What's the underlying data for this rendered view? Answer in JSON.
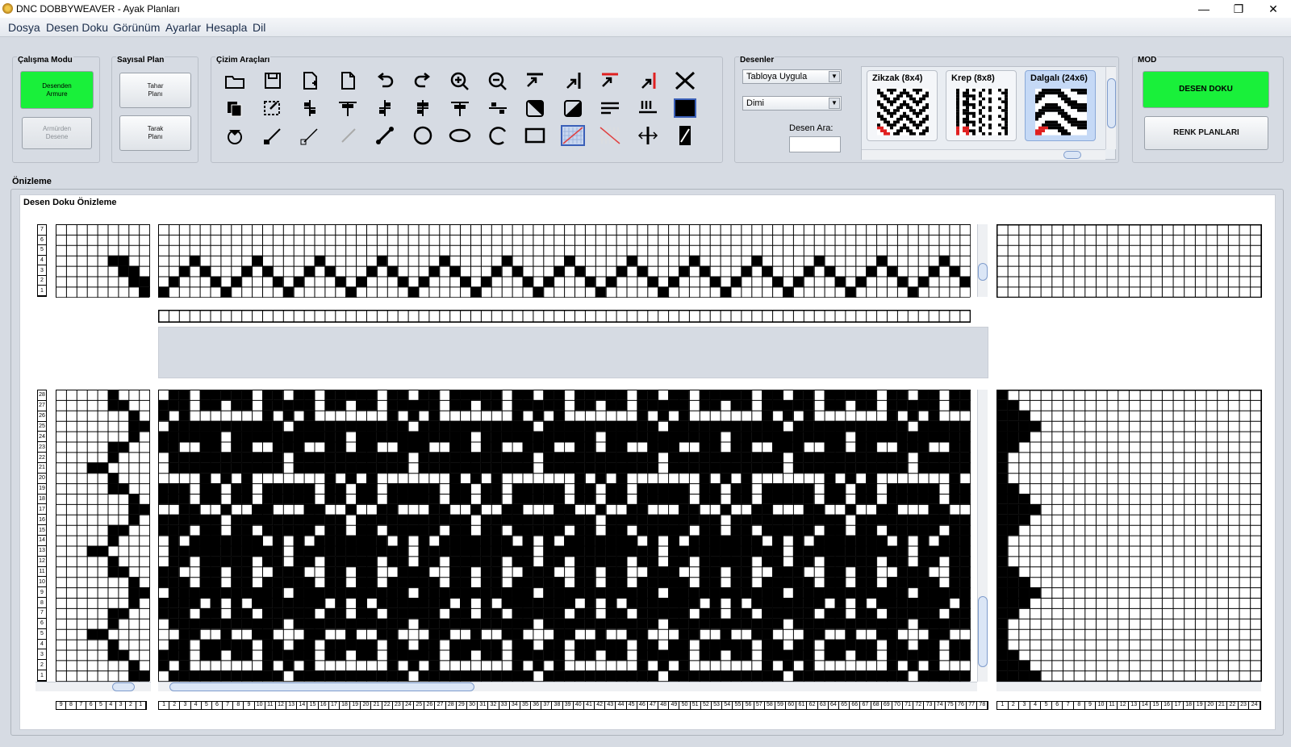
{
  "window": {
    "title": "DNC DOBBYWEAVER - Ayak Planları",
    "minimize": "—",
    "maximize": "❐",
    "close": "✕"
  },
  "menu": [
    "Dosya",
    "Desen Doku",
    "Görünüm",
    "Ayarlar",
    "Hesapla",
    "Dil"
  ],
  "calisma_modu": {
    "title": "Çalışma Modu",
    "btn1": "Desenden\nArmure",
    "btn2": "Armürden\nDesene"
  },
  "sayisal_plan": {
    "title": "Sayısal Plan",
    "btn1": "Tahar\nPlanı",
    "btn2": "Tarak\nPlanı"
  },
  "cizim": {
    "title": "Çizim Araçları",
    "tools": [
      "open-folder-icon",
      "save-icon",
      "new-page-icon",
      "copy-page-icon",
      "undo-icon",
      "redo-icon",
      "zoom-in-icon",
      "zoom-out-icon",
      "align-top-icon",
      "align-right-icon",
      "red-line-icon",
      "red-arrow-icon",
      "close-x-icon",
      "duplicate-icon",
      "select-icon",
      "shift-left-icon",
      "shift-up-icon",
      "shift-down-icon",
      "mirror-icon",
      "flip-icon",
      "compress-icon",
      "invert-icon",
      "fill-icon",
      "rows-icon",
      "columns-icon",
      "black-fill-icon",
      "rotate-icon",
      "line-icon",
      "line-dot-icon",
      "line-light-icon",
      "segment-icon",
      "circle-icon",
      "ellipse-icon",
      "arc-icon",
      "rectangle-icon",
      "grid-fill-icon",
      "diagonal-icon",
      "flip-h-icon",
      "stripe-icon"
    ]
  },
  "desenler": {
    "title": "Desenler",
    "combo1": "Tabloya Uygula",
    "combo2": "Dimi",
    "search_label": "Desen Ara:",
    "search_value": ""
  },
  "patterns": [
    {
      "name": "Zikzak (8x4)"
    },
    {
      "name": "Krep (8x8)"
    },
    {
      "name": "Dalgalı (24x6)"
    }
  ],
  "mod": {
    "title": "MOD",
    "btn1": "DESEN DOKU",
    "btn2": "RENK PLANLARI"
  },
  "preview": {
    "section": "Önizleme",
    "title": "Desen Doku Önizleme"
  },
  "shaft_rows": [
    "7",
    "6",
    "5",
    "4",
    "3",
    "2",
    "1"
  ],
  "treadle_cols": [
    "9",
    "8",
    "7",
    "6",
    "5",
    "4",
    "3",
    "2",
    "1"
  ],
  "pick_rows": [
    "28",
    "27",
    "26",
    "25",
    "24",
    "23",
    "22",
    "21",
    "20",
    "19",
    "18",
    "17",
    "16",
    "15",
    "14",
    "13",
    "12",
    "11",
    "10",
    "9",
    "8",
    "7",
    "6",
    "5",
    "4",
    "3",
    "2",
    "1"
  ],
  "warp_cols": [
    "1",
    "2",
    "3",
    "4",
    "5",
    "6",
    "7",
    "8",
    "9",
    "10",
    "11",
    "12",
    "13",
    "14",
    "15",
    "16",
    "17",
    "18",
    "19",
    "20",
    "21",
    "22",
    "23",
    "24",
    "25",
    "26",
    "27",
    "28",
    "29",
    "30",
    "31",
    "32",
    "33",
    "34",
    "35",
    "36",
    "37",
    "38",
    "39",
    "40",
    "41",
    "42",
    "43",
    "44",
    "45",
    "46",
    "47",
    "48",
    "49",
    "50",
    "51",
    "52",
    "53",
    "54",
    "55",
    "56",
    "57",
    "58",
    "59",
    "60",
    "61",
    "62",
    "63",
    "64",
    "65",
    "66",
    "67",
    "68",
    "69",
    "70",
    "71",
    "72",
    "73",
    "74",
    "75",
    "76",
    "77",
    "78"
  ],
  "color_cols": [
    "1",
    "2",
    "3",
    "4",
    "5",
    "6",
    "7",
    "8",
    "9",
    "10",
    "11",
    "12",
    "13",
    "14",
    "15",
    "16",
    "17",
    "18",
    "19",
    "20",
    "21",
    "22",
    "23",
    "24"
  ],
  "colors": {
    "accent_green": "#19f03a",
    "selected": "#c5d9f6",
    "panel_bg": "#d6dbe3"
  }
}
